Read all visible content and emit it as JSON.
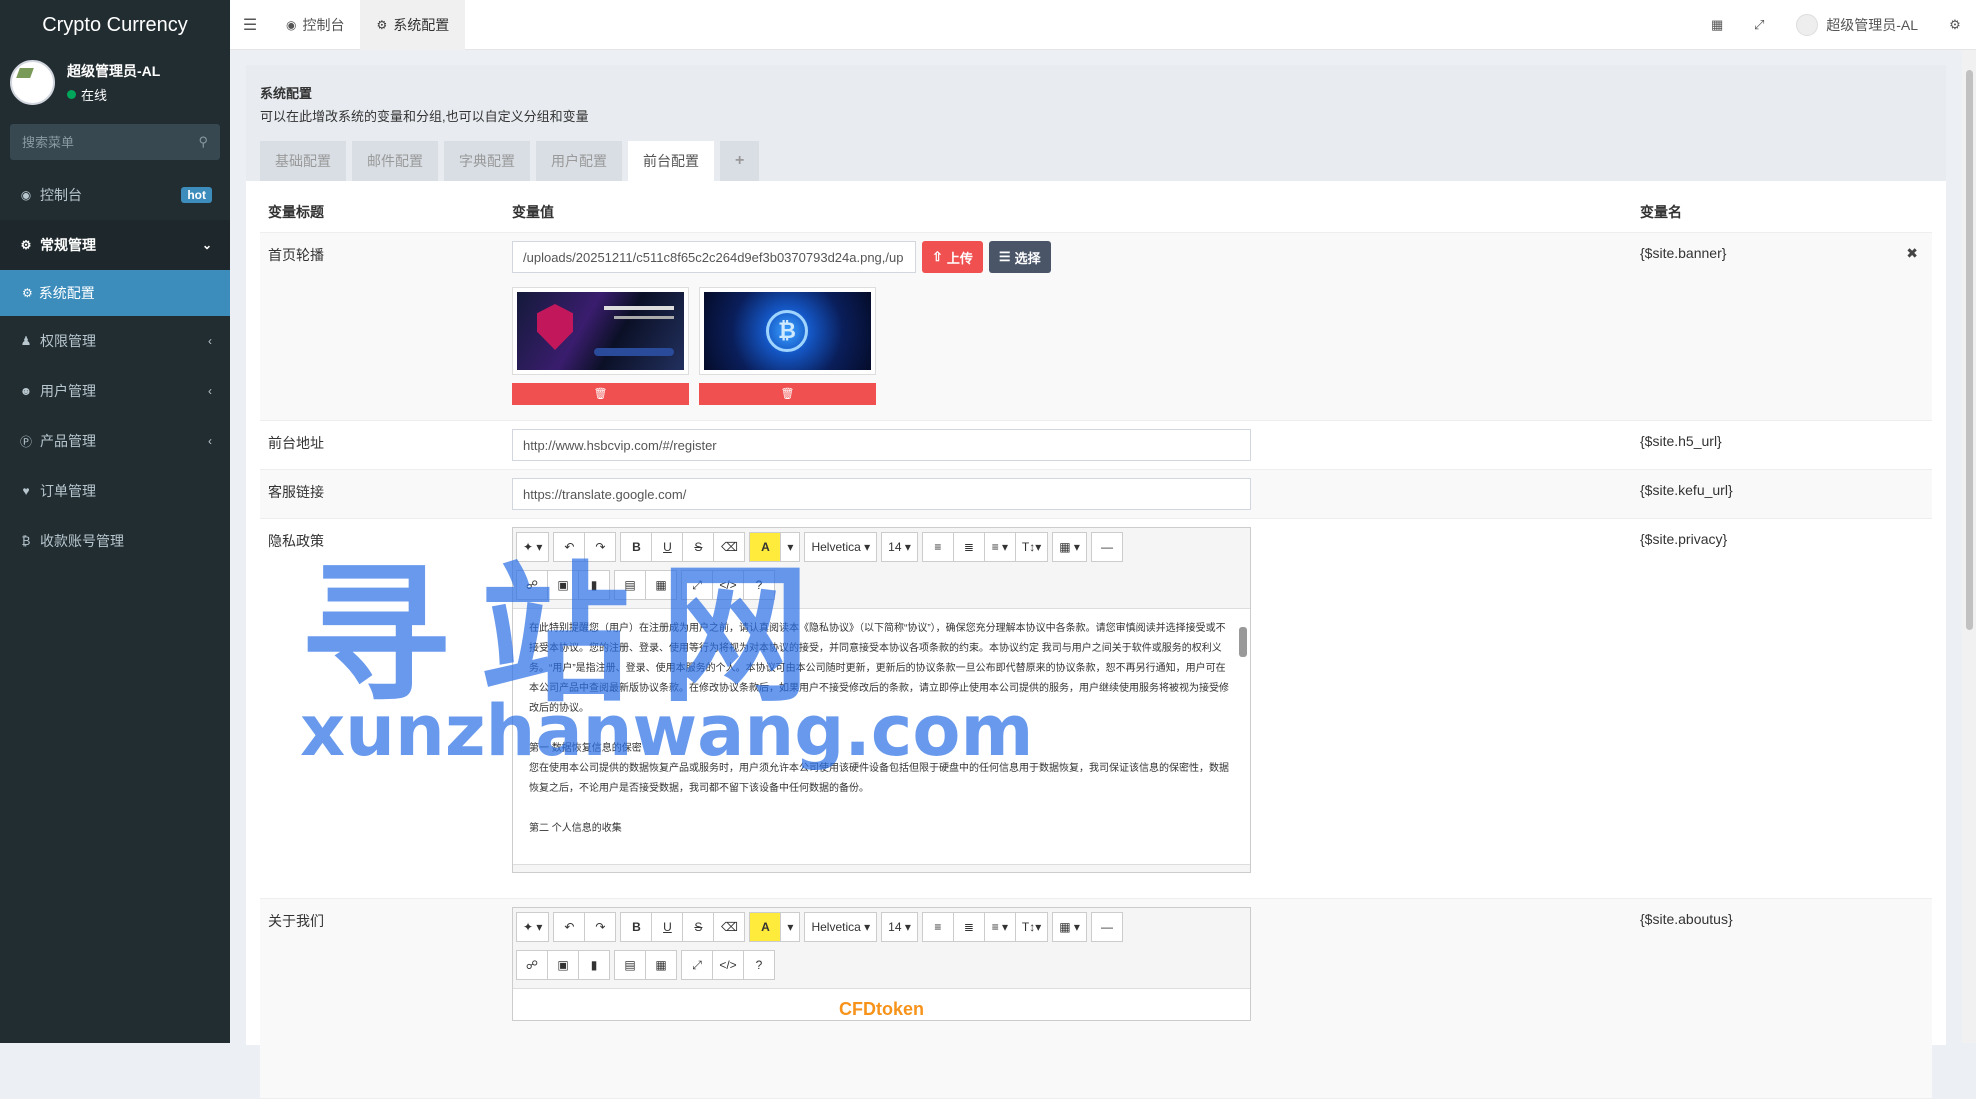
{
  "app": {
    "title": "Crypto Currency"
  },
  "user": {
    "name": "超级管理员-AL",
    "status": "在线"
  },
  "search": {
    "placeholder": "搜索菜单"
  },
  "sidebar": {
    "items": [
      {
        "label": "控制台",
        "badge": "hot"
      },
      {
        "label": "常规管理"
      },
      {
        "label": "系统配置"
      },
      {
        "label": "权限管理"
      },
      {
        "label": "用户管理"
      },
      {
        "label": "产品管理"
      },
      {
        "label": "订单管理"
      },
      {
        "label": "收款账号管理"
      }
    ]
  },
  "header": {
    "tabs": [
      {
        "label": "控制台"
      },
      {
        "label": "系统配置"
      }
    ],
    "user": "超级管理员-AL"
  },
  "panel": {
    "title": "系统配置",
    "desc": "可以在此增改系统的变量和分组,也可以自定义分组和变量",
    "tabs": [
      "基础配置",
      "邮件配置",
      "字典配置",
      "用户配置",
      "前台配置",
      "+"
    ]
  },
  "table": {
    "headers": [
      "变量标题",
      "变量值",
      "变量名"
    ],
    "rows": [
      {
        "title": "首页轮播",
        "value": "/uploads/20251211/c511c8f65c2c264d9ef3b0370793d24a.png,/up",
        "var": "{$site.banner}",
        "upload": "上传",
        "choose": "选择"
      },
      {
        "title": "前台地址",
        "value": "http://www.hsbcvip.com/#/register",
        "var": "{$site.h5_url}"
      },
      {
        "title": "客服链接",
        "value": "https://translate.google.com/",
        "var": "{$site.kefu_url}"
      },
      {
        "title": "隐私政策",
        "var": "{$site.privacy}"
      },
      {
        "title": "关于我们",
        "var": "{$site.aboutus}"
      }
    ]
  },
  "editor": {
    "font": "Helvetica",
    "size": "14",
    "privacy_p1": "在此特别提醒您（用户）在注册成为用户之前，请认真阅读本《隐私协议》（以下简称“协议”），确保您充分理解本协议中各条款。请您审慎阅读并选择接受或不接受本协议。您的注册、登录、使用等行为将视为对本协议的接受，并同意接受本协议各项条款的约束。本协议约定 我司与用户之间关于软件或服务的权利义务。“用户”是指注册、登录、使用本服务的个人。本协议可由本公司随时更新，更新后的协议条款一旦公布即代替原来的协议条款，恕不再另行通知，用户可在本公司产品中查阅最新版协议条款。在修改协议条款后，如果用户不接受修改后的条款，请立即停止使用本公司提供的服务，用户继续使用服务将被视为接受修改后的协议。",
    "privacy_h1": "第一 数据恢复信息的保密",
    "privacy_p2": "您在使用本公司提供的数据恢复产品或服务时，用户须允许本公司使用该硬件设备包括但限于硬盘中的任何信息用于数据恢复，我司保证该信息的保密性，数据恢复之后，不论用户是否接受数据，我司都不留下该设备中任何数据的备份。",
    "privacy_h2": "第二 个人信息的收集",
    "aboutus_text": "CFDtoken"
  },
  "watermark": {
    "line1": "寻站网",
    "line2": "xunzhanwang.com"
  },
  "colors": {
    "sidebar": "#222d32",
    "accent": "#3c8dbc",
    "danger": "#f05050",
    "watermark": "#286ee6"
  }
}
